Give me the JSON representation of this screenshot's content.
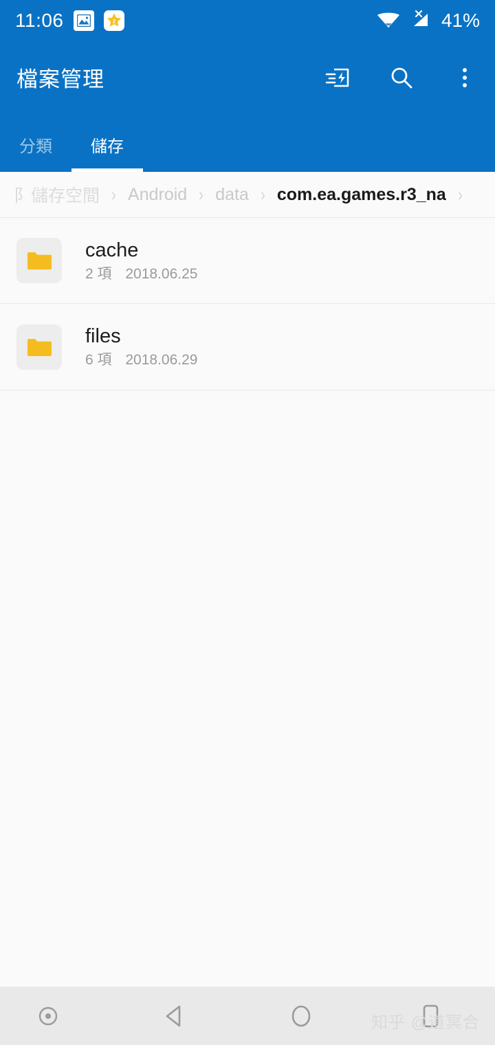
{
  "statusbar": {
    "time": "11:06",
    "battery": "41%",
    "icons": [
      "image-icon",
      "zhihu-star-icon",
      "wifi-icon",
      "cellular-no-sim-icon"
    ]
  },
  "appbar": {
    "title": "檔案管理",
    "actions": [
      {
        "name": "transfer-icon"
      },
      {
        "name": "search-icon"
      },
      {
        "name": "overflow-menu-icon"
      }
    ]
  },
  "tabs": [
    {
      "label": "分類",
      "active": false
    },
    {
      "label": "儲存",
      "active": true
    }
  ],
  "breadcrumb": {
    "items": [
      {
        "label": "阝儲存空間",
        "state": "clipped"
      },
      {
        "label": "Android",
        "state": "normal"
      },
      {
        "label": "data",
        "state": "normal"
      },
      {
        "label": "com.ea.games.r3_na",
        "state": "current"
      }
    ],
    "separator": "›"
  },
  "files": [
    {
      "icon": "folder-icon",
      "name": "cache",
      "count": "2 項",
      "date": "2018.06.25"
    },
    {
      "icon": "folder-icon",
      "name": "files",
      "count": "6 項",
      "date": "2018.06.29"
    }
  ],
  "navbar": {
    "buttons": [
      {
        "name": "screen-record-icon"
      },
      {
        "name": "back-icon"
      },
      {
        "name": "home-icon"
      },
      {
        "name": "recents-icon"
      }
    ]
  },
  "watermark": {
    "text": "知乎 @道冥合"
  },
  "colors": {
    "accent": "#0a72c4",
    "folder": "#f5bc1f",
    "tile": "#ededed",
    "background": "#fafafa",
    "navbar": "#e9e9e9"
  }
}
